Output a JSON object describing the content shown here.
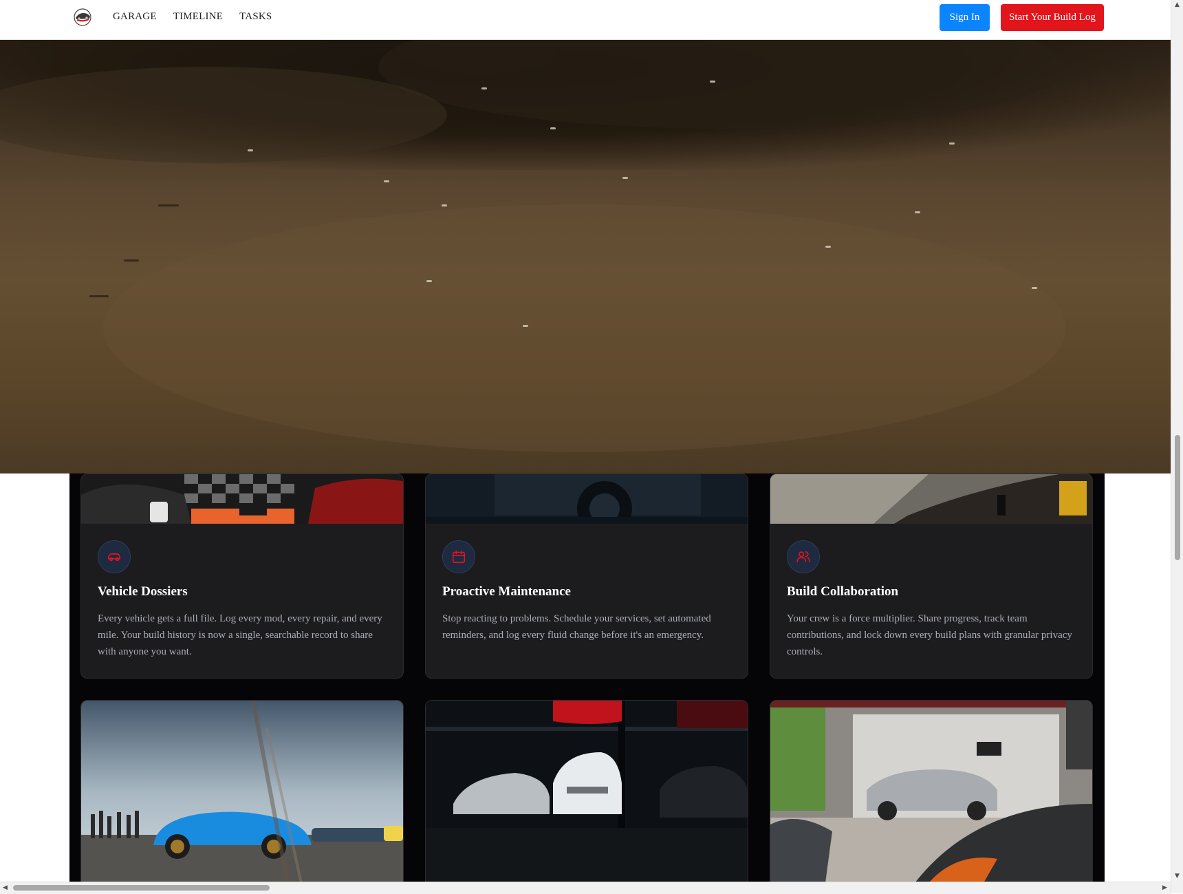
{
  "header": {
    "logo_icon": "car-logo-icon",
    "nav": [
      "GARAGE",
      "TIMELINE",
      "TASKS"
    ],
    "sign_in": "Sign In",
    "start_build": "Start Your Build Log",
    "colors": {
      "sign_in": "#0b84ff",
      "start_build": "#e2141c"
    }
  },
  "features": [
    {
      "icon": "car-icon",
      "title": "Vehicle Dossiers",
      "description": "Every vehicle gets a full file. Log every mod, every repair, and every mile. Your build history is now a single, searchable record to share with anyone you want."
    },
    {
      "icon": "calendar-icon",
      "title": "Proactive Maintenance",
      "description": "Stop reacting to problems. Schedule your services, set automated reminders, and log every fluid change before it's an emergency."
    },
    {
      "icon": "users-icon",
      "title": "Build Collaboration",
      "description": "Your crew is a force multiplier. Share progress, track team contributions, and lock down every build plans with granular privacy controls."
    }
  ],
  "accent_color": "#e2141c"
}
